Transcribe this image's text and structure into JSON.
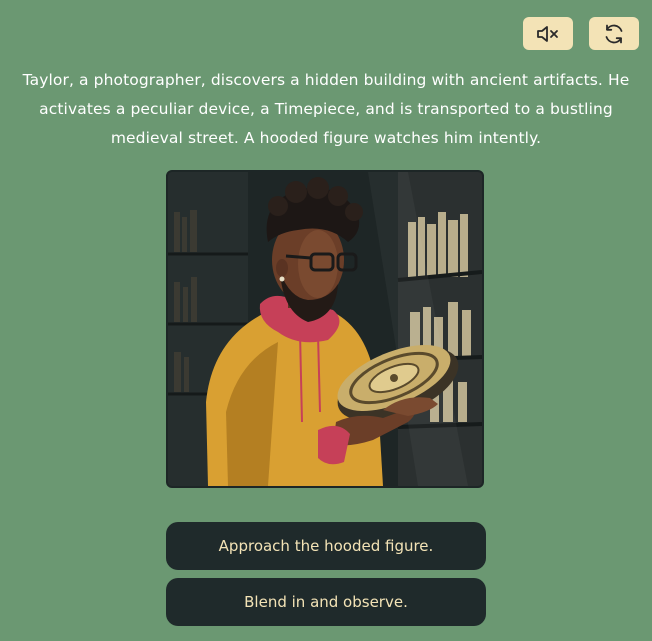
{
  "controls": {
    "mute_icon": "speaker-muted-icon",
    "restart_icon": "refresh-icon",
    "button_color": "#f3e3b6"
  },
  "story": {
    "text": "Taylor, a photographer, discovers a hidden building with ancient artifacts. He activates a peculiar device, a Timepiece, and is transported to a bustling medieval street. A hooded figure watches him intently."
  },
  "scene": {
    "illustration": "man-holding-timepiece-in-library"
  },
  "choices": [
    {
      "label": "Approach the hooded figure."
    },
    {
      "label": "Blend in and observe."
    }
  ],
  "theme": {
    "background": "#6b9872",
    "choice_background": "#1f2a2b",
    "choice_text": "#f3e3b6"
  }
}
